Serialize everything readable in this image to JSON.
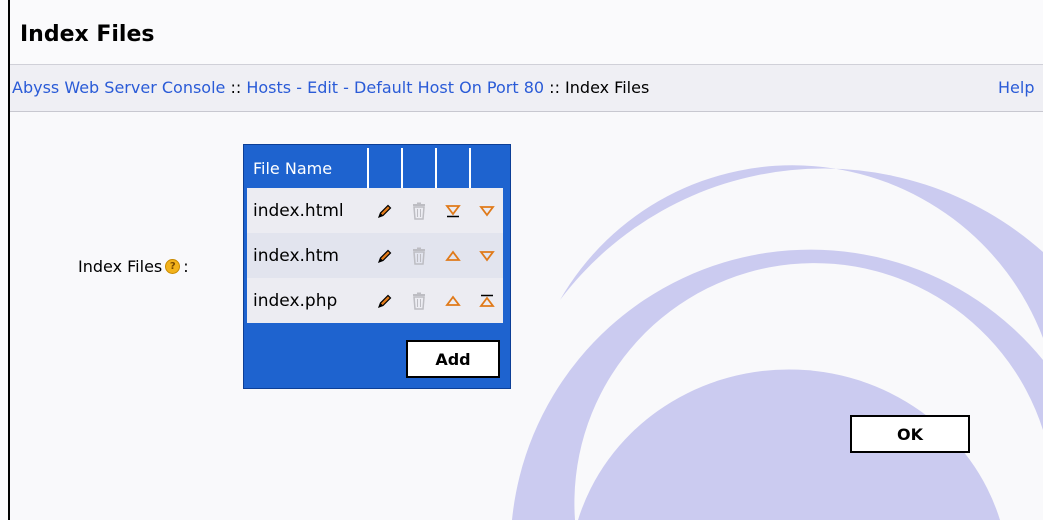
{
  "page": {
    "title": "Index Files"
  },
  "breadcrumb": {
    "console_label": "Abyss Web Server Console",
    "separator": "::",
    "hosts_label": "Hosts",
    "dash": "-",
    "edit_label": "Edit",
    "host_label": "Default Host On Port 80",
    "current_label": "Index Files"
  },
  "help_link": "Help",
  "form": {
    "field_label": "Index Files",
    "field_colon": ":",
    "help_icon": "?"
  },
  "table": {
    "header": "File Name",
    "rows": [
      {
        "name": "index.html",
        "actions": [
          "edit-icon",
          "delete-icon",
          "move-to-bottom-icon",
          "move-down-icon"
        ]
      },
      {
        "name": "index.htm",
        "actions": [
          "edit-icon",
          "delete-icon",
          "move-up-icon",
          "move-down-icon"
        ]
      },
      {
        "name": "index.php",
        "actions": [
          "edit-icon",
          "delete-icon",
          "move-up-icon",
          "move-to-top-icon"
        ]
      }
    ],
    "add_label": "Add"
  },
  "ok_label": "OK",
  "colors": {
    "table_blue": "#1e63cf",
    "link": "#2a5bd7",
    "arrow_orange": "#e07a1a",
    "watermark": "#cbcbf0"
  }
}
